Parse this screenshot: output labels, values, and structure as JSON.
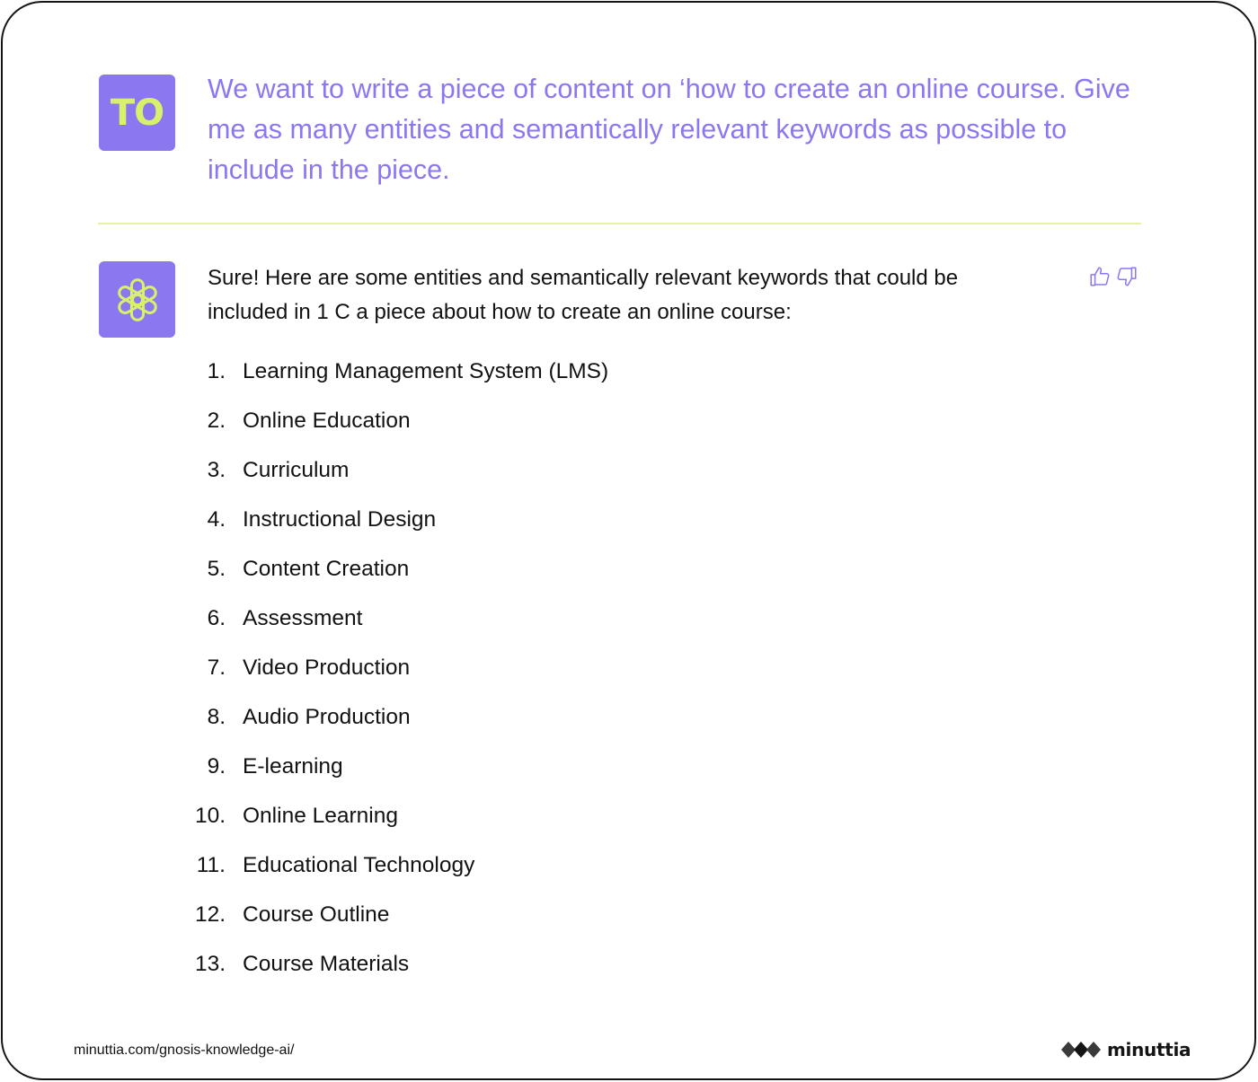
{
  "user": {
    "initials": "TO",
    "message": "We want to write a piece of content on ‘how to create an online course. Give me as many entities and semantically relevant keywords as possible to include in the piece."
  },
  "assistant": {
    "icon": "openai-logo-icon",
    "intro": "Sure! Here are some entities and semantically relevant keywords that could be included in 1 C a piece about how to create an online course:",
    "items": [
      {
        "num": "1.",
        "text": "Learning Management System (LMS)"
      },
      {
        "num": "2.",
        "text": "Online Education"
      },
      {
        "num": "3.",
        "text": "Curriculum"
      },
      {
        "num": "4.",
        "text": "Instructional Design"
      },
      {
        "num": "5.",
        "text": "Content Creation"
      },
      {
        "num": "6.",
        "text": "Assessment"
      },
      {
        "num": "7.",
        "text": "Video Production"
      },
      {
        "num": "8.",
        "text": "Audio Production"
      },
      {
        "num": "9.",
        "text": "E-learning"
      },
      {
        "num": "10.",
        "text": "Online Learning"
      },
      {
        "num": "11.",
        "text": "Educational Technology"
      },
      {
        "num": "12.",
        "text": "Course Outline"
      },
      {
        "num": "13.",
        "text": "Course Materials"
      }
    ]
  },
  "feedback": {
    "up_icon": "thumbs-up-icon",
    "down_icon": "thumbs-down-icon"
  },
  "footer": {
    "url": "minuttia.com/gnosis-knowledge-ai/",
    "brand": "minuttia"
  },
  "colors": {
    "accent": "#8b78f0",
    "highlight": "#d8f16b",
    "divider": "#e4f2a4",
    "text": "#121212"
  }
}
